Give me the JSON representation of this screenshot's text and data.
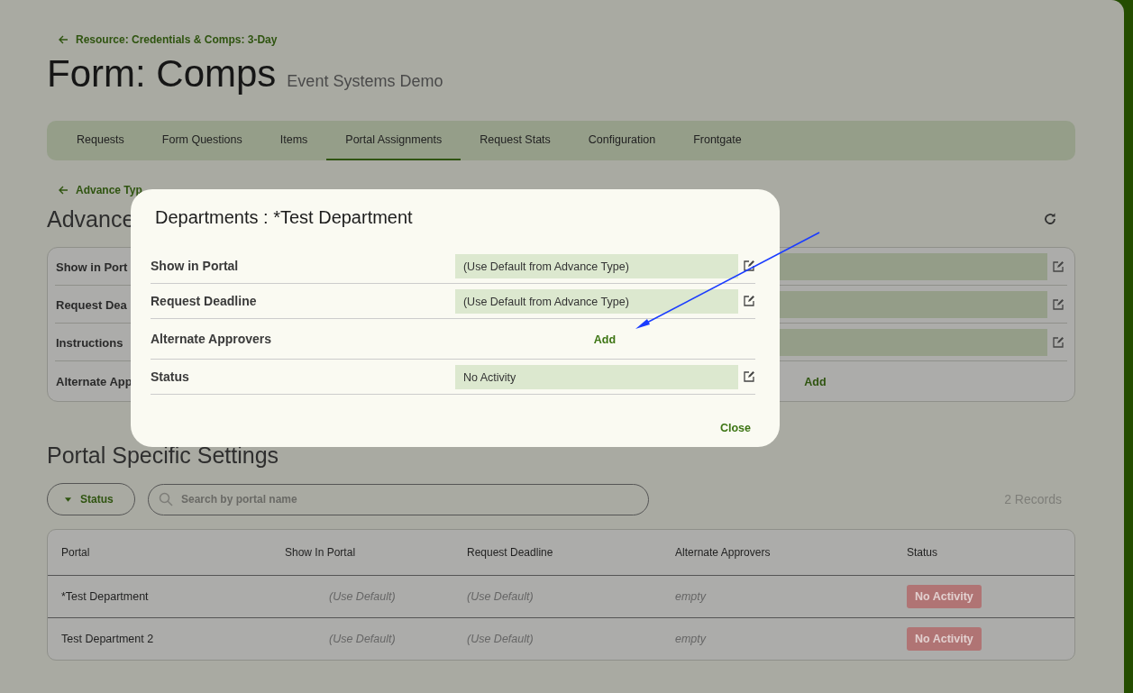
{
  "breadcrumb": {
    "label": "Resource: Credentials & Comps: 3-Day"
  },
  "title": "Form: Comps",
  "subtitle": "Event Systems Demo",
  "tabs": [
    {
      "label": "Requests",
      "selected": false
    },
    {
      "label": "Form Questions",
      "selected": false
    },
    {
      "label": "Items",
      "selected": false
    },
    {
      "label": "Portal Assignments",
      "selected": true
    },
    {
      "label": "Request Stats",
      "selected": false
    },
    {
      "label": "Configuration",
      "selected": false
    },
    {
      "label": "Frontgate",
      "selected": false
    }
  ],
  "advance_type": {
    "back_link": "Advance Typ",
    "heading": "Advance",
    "rows": [
      {
        "kind": "field",
        "label": "Show in Port"
      },
      {
        "kind": "field",
        "label": "Request Dea"
      },
      {
        "kind": "field",
        "label": "Instructions"
      },
      {
        "kind": "add",
        "label": "Alternate App",
        "action": "Add"
      }
    ]
  },
  "portal_settings": {
    "heading": "Portal Specific Settings",
    "filter": {
      "label": "Status"
    },
    "search": {
      "placeholder": "Search by portal name"
    },
    "record_count": "2 Records",
    "table": {
      "columns": [
        "Portal",
        "Show In Portal",
        "Request Deadline",
        "Alternate Approvers",
        "Status"
      ],
      "rows": [
        {
          "portal": "*Test Department",
          "show_in_portal": "(Use Default)",
          "request_deadline": "(Use Default)",
          "alternate_approvers": "empty",
          "status": "No Activity"
        },
        {
          "portal": "Test Department 2",
          "show_in_portal": "(Use Default)",
          "request_deadline": "(Use Default)",
          "alternate_approvers": "empty",
          "status": "No Activity"
        }
      ]
    }
  },
  "dialog": {
    "title": "Departments : *Test Department",
    "rows": [
      {
        "kind": "field",
        "label": "Show in Portal",
        "value": "(Use Default from Advance Type)"
      },
      {
        "kind": "field",
        "label": "Request Deadline",
        "value": "(Use Default from Advance Type)"
      },
      {
        "kind": "add",
        "label": "Alternate Approvers",
        "action": "Add"
      },
      {
        "kind": "field",
        "label": "Status",
        "value": "No Activity"
      }
    ],
    "close": "Close"
  }
}
